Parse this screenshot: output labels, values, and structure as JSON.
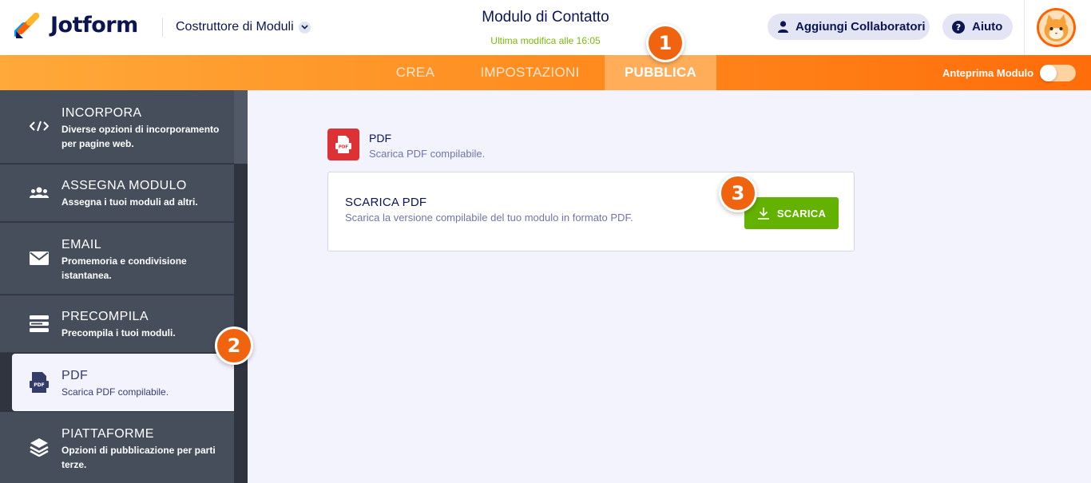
{
  "header": {
    "logo_text": "Jotform",
    "builder_label": "Costruttore di Moduli",
    "form_title": "Modulo di Contatto",
    "last_modified": "Ultima modifica alle 16:05",
    "collab_button": "Aggiungi Collaboratori",
    "help_button": "Aiuto"
  },
  "nav": {
    "tabs": [
      {
        "label": "CREA"
      },
      {
        "label": "IMPOSTAZIONI"
      },
      {
        "label": "PUBBLICA",
        "active": true
      }
    ],
    "preview_label": "Anteprima Modulo",
    "preview_enabled": false
  },
  "sidebar": {
    "items": [
      {
        "title": "INCORPORA",
        "desc": "Diverse opzioni di incorporamento per pagine web.",
        "icon": "code-icon"
      },
      {
        "title": "ASSEGNA MODULO",
        "desc": "Assegna i tuoi moduli ad altri.",
        "icon": "users-icon"
      },
      {
        "title": "EMAIL",
        "desc": "Promemoria e condivisione istantanea.",
        "icon": "envelope-icon"
      },
      {
        "title": "PRECOMPILA",
        "desc": "Precompila i tuoi moduli.",
        "icon": "prefill-icon"
      },
      {
        "title": "PDF",
        "desc": "Scarica PDF compilabile.",
        "icon": "pdf-icon",
        "active": true
      },
      {
        "title": "PIATTAFORME",
        "desc": "Opzioni di pubblicazione per parti terze.",
        "icon": "layers-icon"
      }
    ]
  },
  "main": {
    "section_title": "PDF",
    "section_desc": "Scarica PDF compilabile.",
    "card_title": "SCARICA PDF",
    "card_desc": "Scarica la versione compilabile del tuo modulo in formato PDF.",
    "download_button": "SCARICA"
  },
  "steps": [
    "1",
    "2",
    "3"
  ],
  "colors": {
    "brand_navy": "#0a1551",
    "orange": "#ff6100",
    "green": "#64b200",
    "pdf_red": "#dd3136",
    "sidebar_bg": "#464e5c"
  }
}
